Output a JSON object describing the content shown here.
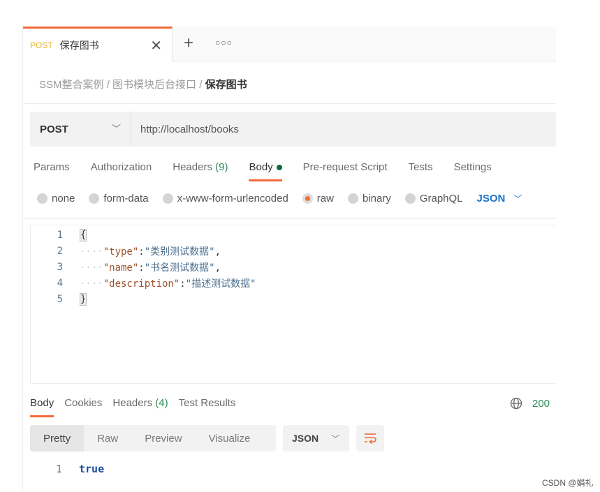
{
  "tab": {
    "method": "POST",
    "title": "保存图书",
    "close_icon": "close-icon"
  },
  "breadcrumb": {
    "items": [
      "SSM整合案例",
      "图书模块后台接口"
    ],
    "current": "保存图书",
    "separator": "/"
  },
  "request": {
    "method": "POST",
    "url": "http://localhost/books"
  },
  "request_tabs": {
    "params": "Params",
    "authorization": "Authorization",
    "headers": "Headers",
    "headers_count": "(9)",
    "body": "Body",
    "prerequest": "Pre-request Script",
    "tests": "Tests",
    "settings": "Settings"
  },
  "body_types": {
    "none": "none",
    "form_data": "form-data",
    "urlencoded": "x-www-form-urlencoded",
    "raw": "raw",
    "binary": "binary",
    "graphql": "GraphQL",
    "language": "JSON",
    "selected": "raw"
  },
  "editor": {
    "lines": [
      "1",
      "2",
      "3",
      "4",
      "5"
    ],
    "open": "{",
    "close": "}",
    "k1": "\"type\"",
    "v1": "\"类别测试数据\"",
    "k2": "\"name\"",
    "v2": "\"书名测试数据\"",
    "k3": "\"description\"",
    "v3": "\"描述测试数据\""
  },
  "response_tabs": {
    "body": "Body",
    "cookies": "Cookies",
    "headers": "Headers",
    "headers_count": "(4)",
    "test_results": "Test Results",
    "status": "200"
  },
  "response_view": {
    "pretty": "Pretty",
    "raw": "Raw",
    "preview": "Preview",
    "visualize": "Visualize",
    "format": "JSON"
  },
  "response_body": {
    "line": "1",
    "value": "true"
  },
  "watermark": "CSDN @娟礼",
  "colors": {
    "accent": "#f26b3a",
    "link": "#1a73c9",
    "success": "#2e8b57"
  }
}
